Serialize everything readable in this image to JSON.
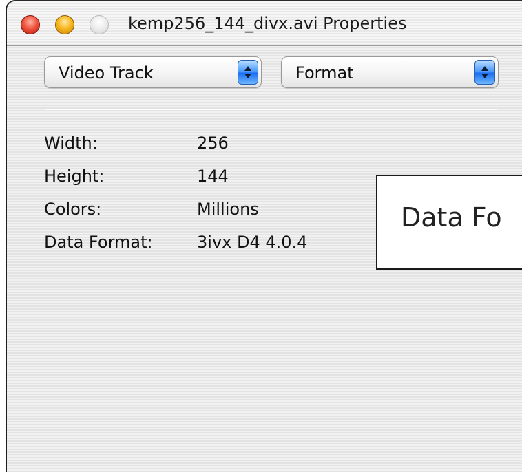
{
  "window": {
    "title": "kemp256_144_divx.avi Properties",
    "buttons": {
      "close": "close-button",
      "minimize": "minimize-button",
      "zoom": "zoom-button"
    }
  },
  "popups": {
    "track": {
      "selected": "Video Track"
    },
    "format": {
      "selected": "Format"
    }
  },
  "properties": [
    {
      "label": "Width:",
      "value": "256"
    },
    {
      "label": "Height:",
      "value": "144"
    },
    {
      "label": "Colors:",
      "value": "Millions"
    },
    {
      "label": "Data Format:",
      "value": "3ivx D4 4.0.4"
    }
  ],
  "tooltip": {
    "text": "Data Fo"
  },
  "colors": {
    "close": "#f0563f",
    "minimize": "#f8b81f",
    "popup_accent": "#4f9dff"
  }
}
